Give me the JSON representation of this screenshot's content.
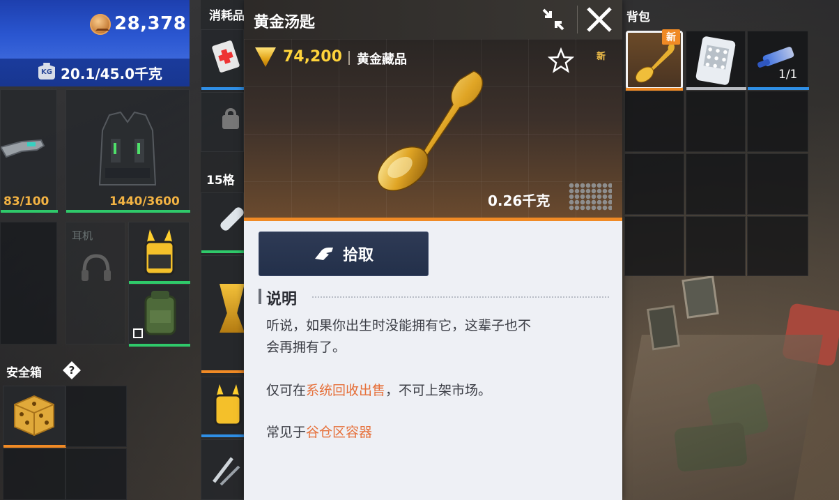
{
  "player": {
    "currency": "28,378",
    "weight": "20.1/45.0千克"
  },
  "equipment": {
    "weapon_durability": "83/100",
    "armor_durability": "1440/3600",
    "headset_label": "耳机"
  },
  "safe_box": {
    "title": "安全箱",
    "help": "?"
  },
  "middle_list": {
    "consumables_title": "消耗品",
    "grid_15_title": "15格"
  },
  "item_detail": {
    "title": "黄金汤匙",
    "price": "74,200",
    "category": "黄金藏品",
    "new_label": "新",
    "weight": "0.26千克",
    "pickup_label": "拾取",
    "description_title": "说明",
    "description_line1": "听说，如果你出生时没能拥有它，这辈子也不",
    "description_line2": "会再拥有了。",
    "sell_prefix": "仅可在",
    "sell_link": "系统回收出售",
    "sell_suffix": "，不可上架市场。",
    "found_prefix": "常见于",
    "found_link": "谷仓区容器"
  },
  "backpack": {
    "title": "背包",
    "new_badge": "新",
    "battery_qty": "1/1"
  },
  "colors": {
    "accent_orange": "#f08a25",
    "gold": "#ffd43b",
    "link": "#e6703a",
    "durability_green": "#2fc96a",
    "rarity_blue": "#2f8fe6"
  },
  "icons": [
    "coin-icon",
    "weight-icon",
    "star-icon",
    "collapse-icon",
    "close-icon",
    "hand-icon",
    "help-icon",
    "lock-icon"
  ]
}
